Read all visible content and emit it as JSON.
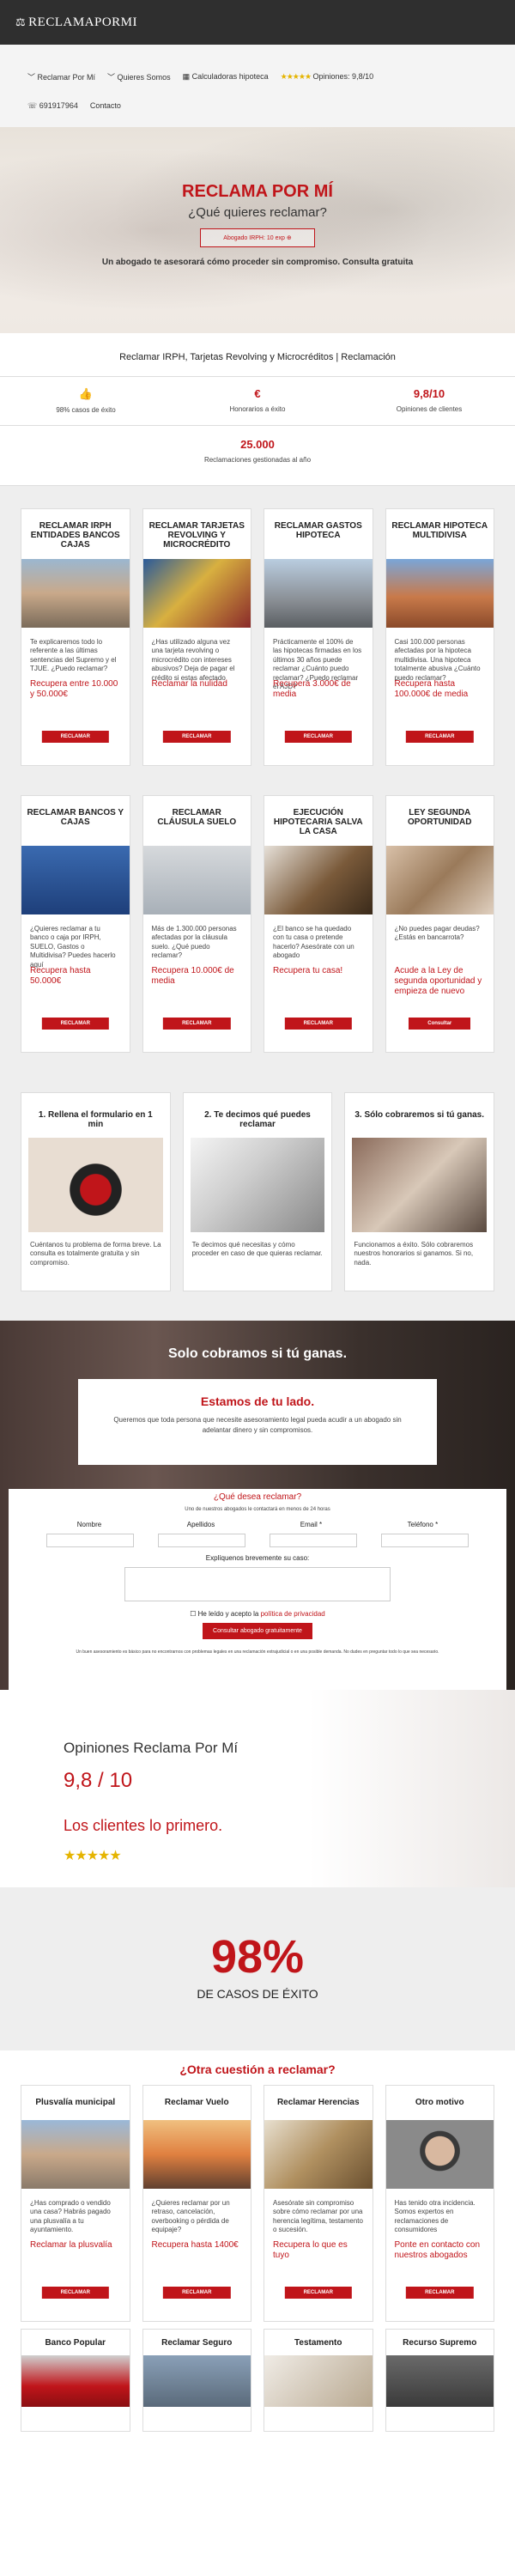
{
  "brand": "RECLAMAPORMI",
  "nav": {
    "items": [
      "Reclamar Por Mí",
      "Quieres Somos",
      "Calculadoras hipoteca"
    ],
    "opinions": "Opiniones: 9,8/10",
    "phone": "691917964",
    "contact": "Contacto"
  },
  "hero": {
    "title": "RECLAMA POR MÍ",
    "question": "¿Qué quieres reclamar?",
    "select": "Abogado IRPH: 10 exp ⊕",
    "sub": "Un abogado te asesorará cómo proceder sin compromiso. Consulta gratuita"
  },
  "seo": "Reclamar IRPH, Tarjetas Revolving y Microcréditos | Reclamación",
  "stats": [
    {
      "icon": "👍",
      "label": "98% casos de éxito"
    },
    {
      "icon": "€",
      "label": "Honorarios a éxito"
    },
    {
      "icon": "9,8/10",
      "label": "Opiniones de clientes"
    }
  ],
  "total": {
    "number": "25.000",
    "label": "Reclamaciones gestionadas al año"
  },
  "cards1": [
    {
      "title": "RECLAMAR IRPH ENTIDADES BANCOS CAJAS",
      "text": "Te explicaremos todo lo referente a las últimas sentencias del Supremo y el TJUE. ¿Puedo reclamar?",
      "rec": "Recupera entre 10.000 y 50.000€",
      "btn": "RECLAMAR"
    },
    {
      "title": "RECLAMAR TARJETAS REVOLVING Y MICROCRÉDITO",
      "text": "¿Has utilizado alguna vez una tarjeta revolving o microcrédito con intereses abusivos? Deja de pagar el crédito si estas afectado",
      "rec": "Reclamar la nulidad",
      "btn": "RECLAMAR"
    },
    {
      "title": "RECLAMAR GASTOS HIPOTECA",
      "text": "Prácticamente el 100% de las hipotecas firmadas en los últimos 30 años puede reclamar ¿Cuánto puedo reclamar? ¿Puedo reclamar el AJD?",
      "rec": "Recupera 3.000€ de media",
      "btn": "RECLAMAR"
    },
    {
      "title": "RECLAMAR HIPOTECA MULTIDIVISA",
      "text": "Casi 100.000 personas afectadas por la hipoteca multidivisa. Una hipoteca totalmente abusiva ¿Cuánto puedo reclamar?",
      "rec": "Recupera hasta 100.000€ de media",
      "btn": "RECLAMAR"
    }
  ],
  "cards2": [
    {
      "title": "RECLAMAR BANCOS Y CAJAS",
      "text": "¿Quieres reclamar a tu banco o caja por IRPH, SUELO, Gastos o Multidivisa? Puedes hacerlo aquí",
      "rec": "Recupera hasta 50.000€",
      "btn": "RECLAMAR"
    },
    {
      "title": "RECLAMAR CLÁUSULA SUELO",
      "text": "Más de 1.300.000 personas afectadas por la cláusula suelo. ¿Qué puedo reclamar?",
      "rec": "Recupera 10.000€ de media",
      "btn": "RECLAMAR"
    },
    {
      "title": "EJECUCIÓN HIPOTECARIA SALVA LA CASA",
      "text": "¿El banco se ha quedado con tu casa o pretende hacerlo? Asesórate con un abogado",
      "rec": "Recupera tu casa!",
      "btn": "RECLAMAR"
    },
    {
      "title": "LEY SEGUNDA OPORTUNIDAD",
      "text": "¿No puedes pagar deudas? ¿Estás en bancarrota?",
      "rec": "Acude a la Ley de segunda oportunidad y empieza de nuevo",
      "btn": "Consultar"
    }
  ],
  "steps": [
    {
      "title": "1. Rellena el formulario en 1 min",
      "text": "Cuéntanos tu problema de forma breve. La consulta es totalmente gratuita y sin compromiso."
    },
    {
      "title": "2. Te decimos qué puedes reclamar",
      "text": "Te decimos qué necesitas y cómo proceder en caso de que quieras reclamar."
    },
    {
      "title": "3. Sólo cobraremos si tú ganas.",
      "text": "Funcionamos a éxito. Sólo cobraremos nuestros honorarios si ganamos. Si no, nada."
    }
  ],
  "dark": {
    "title": "Solo cobramos si tú ganas.",
    "box_title": "Estamos de tu lado.",
    "box_text": "Queremos que toda persona que necesite asesoramiento legal pueda acudir a un abogado sin adelantar dinero y sin compromisos."
  },
  "form": {
    "question": "¿Qué desea reclamar?",
    "sub": "Uno de nuestros abogados le contactará en menos de 24 horas",
    "labels": [
      "Nombre",
      "Apellidos",
      "Email *",
      "Teléfono *"
    ],
    "explain": "Explíquenos brevemente su caso:",
    "check": "He leído y acepto la",
    "policy": "política de privacidad",
    "submit": "Consultar abogado gratuitamente",
    "legal": "Un buen asesoramiento es básico para no encontrarnos con problemas legales en una reclamación extrajudicial o en una posible demanda. No dudes en preguntar todo lo que sea necesario."
  },
  "opinions": {
    "title": "Opiniones Reclama Por Mí",
    "score": "9,8 / 10",
    "slogan": "Los clientes lo primero.",
    "stars": "★★★★★"
  },
  "pct": {
    "number": "98%",
    "label": "DE CASOS DE ÉXITO"
  },
  "other": {
    "title": "¿Otra cuestión a reclamar?"
  },
  "cards3": [
    {
      "title": "Plusvalía municipal",
      "text": "¿Has comprado o vendido una casa? Habrás pagado una plusvalía a tu ayuntamiento.",
      "rec": "Reclamar la plusvalía",
      "btn": "RECLAMAR"
    },
    {
      "title": "Reclamar Vuelo",
      "text": "¿Quieres reclamar por un retraso, cancelación, overbooking o pérdida de equipaje?",
      "rec": "Recupera hasta 1400€",
      "btn": "RECLAMAR"
    },
    {
      "title": "Reclamar Herencias",
      "text": "Asesórate sin compromiso sobre cómo reclamar por una herencia legítima, testamento o sucesión.",
      "rec": "Recupera lo que es tuyo",
      "btn": "RECLAMAR"
    },
    {
      "title": "Otro motivo",
      "text": "Has tenido otra incidencia. Somos expertos en reclamaciones de consumidores",
      "rec": "Ponte en contacto con nuestros abogados",
      "btn": "RECLAMAR"
    }
  ],
  "cards4": [
    {
      "title": "Banco Popular"
    },
    {
      "title": "Reclamar Seguro"
    },
    {
      "title": "Testamento"
    },
    {
      "title": "Recurso Supremo"
    }
  ]
}
